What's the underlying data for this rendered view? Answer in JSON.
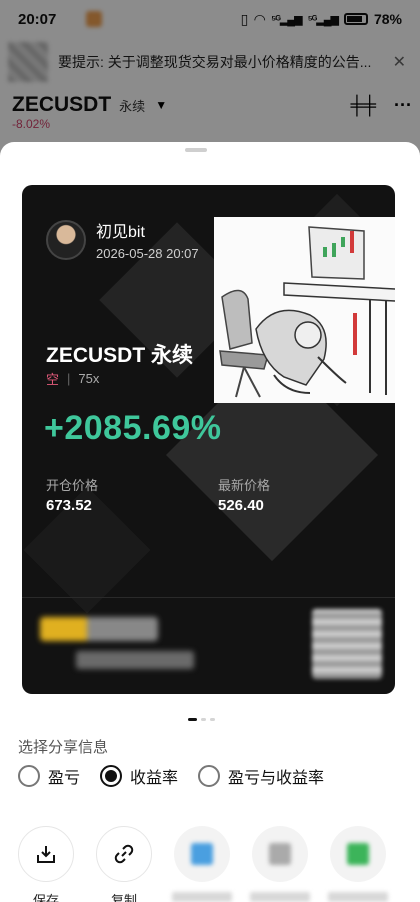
{
  "status_bar": {
    "time": "20:07",
    "battery": "78%",
    "signal_label": "5G"
  },
  "notice": {
    "text": "要提示: 关于调整现货交易对最小价格精度的公告...",
    "close": "✕"
  },
  "pair": {
    "name": "ZECUSDT",
    "type": "永续",
    "change": "-8.02%",
    "more": "···"
  },
  "card": {
    "user_name": "初见bit",
    "date": "2026-05-28 20:07",
    "symbol": "ZECUSDT 永续",
    "direction": "空",
    "leverage": "75x",
    "pnl_percent": "+2085.69%",
    "open_price_label": "开仓价格",
    "open_price": "673.52",
    "latest_price_label": "最新价格",
    "latest_price": "526.40"
  },
  "share": {
    "title": "选择分享信息",
    "options": [
      {
        "label": "盈亏",
        "selected": false
      },
      {
        "label": "收益率",
        "selected": true
      },
      {
        "label": "盈亏与收益率",
        "selected": false
      }
    ]
  },
  "actions": {
    "save": "保存",
    "copy": "复制"
  },
  "colors": {
    "pnl": "#3fc79b",
    "short": "#e25a7a",
    "negative": "#d0426a"
  }
}
